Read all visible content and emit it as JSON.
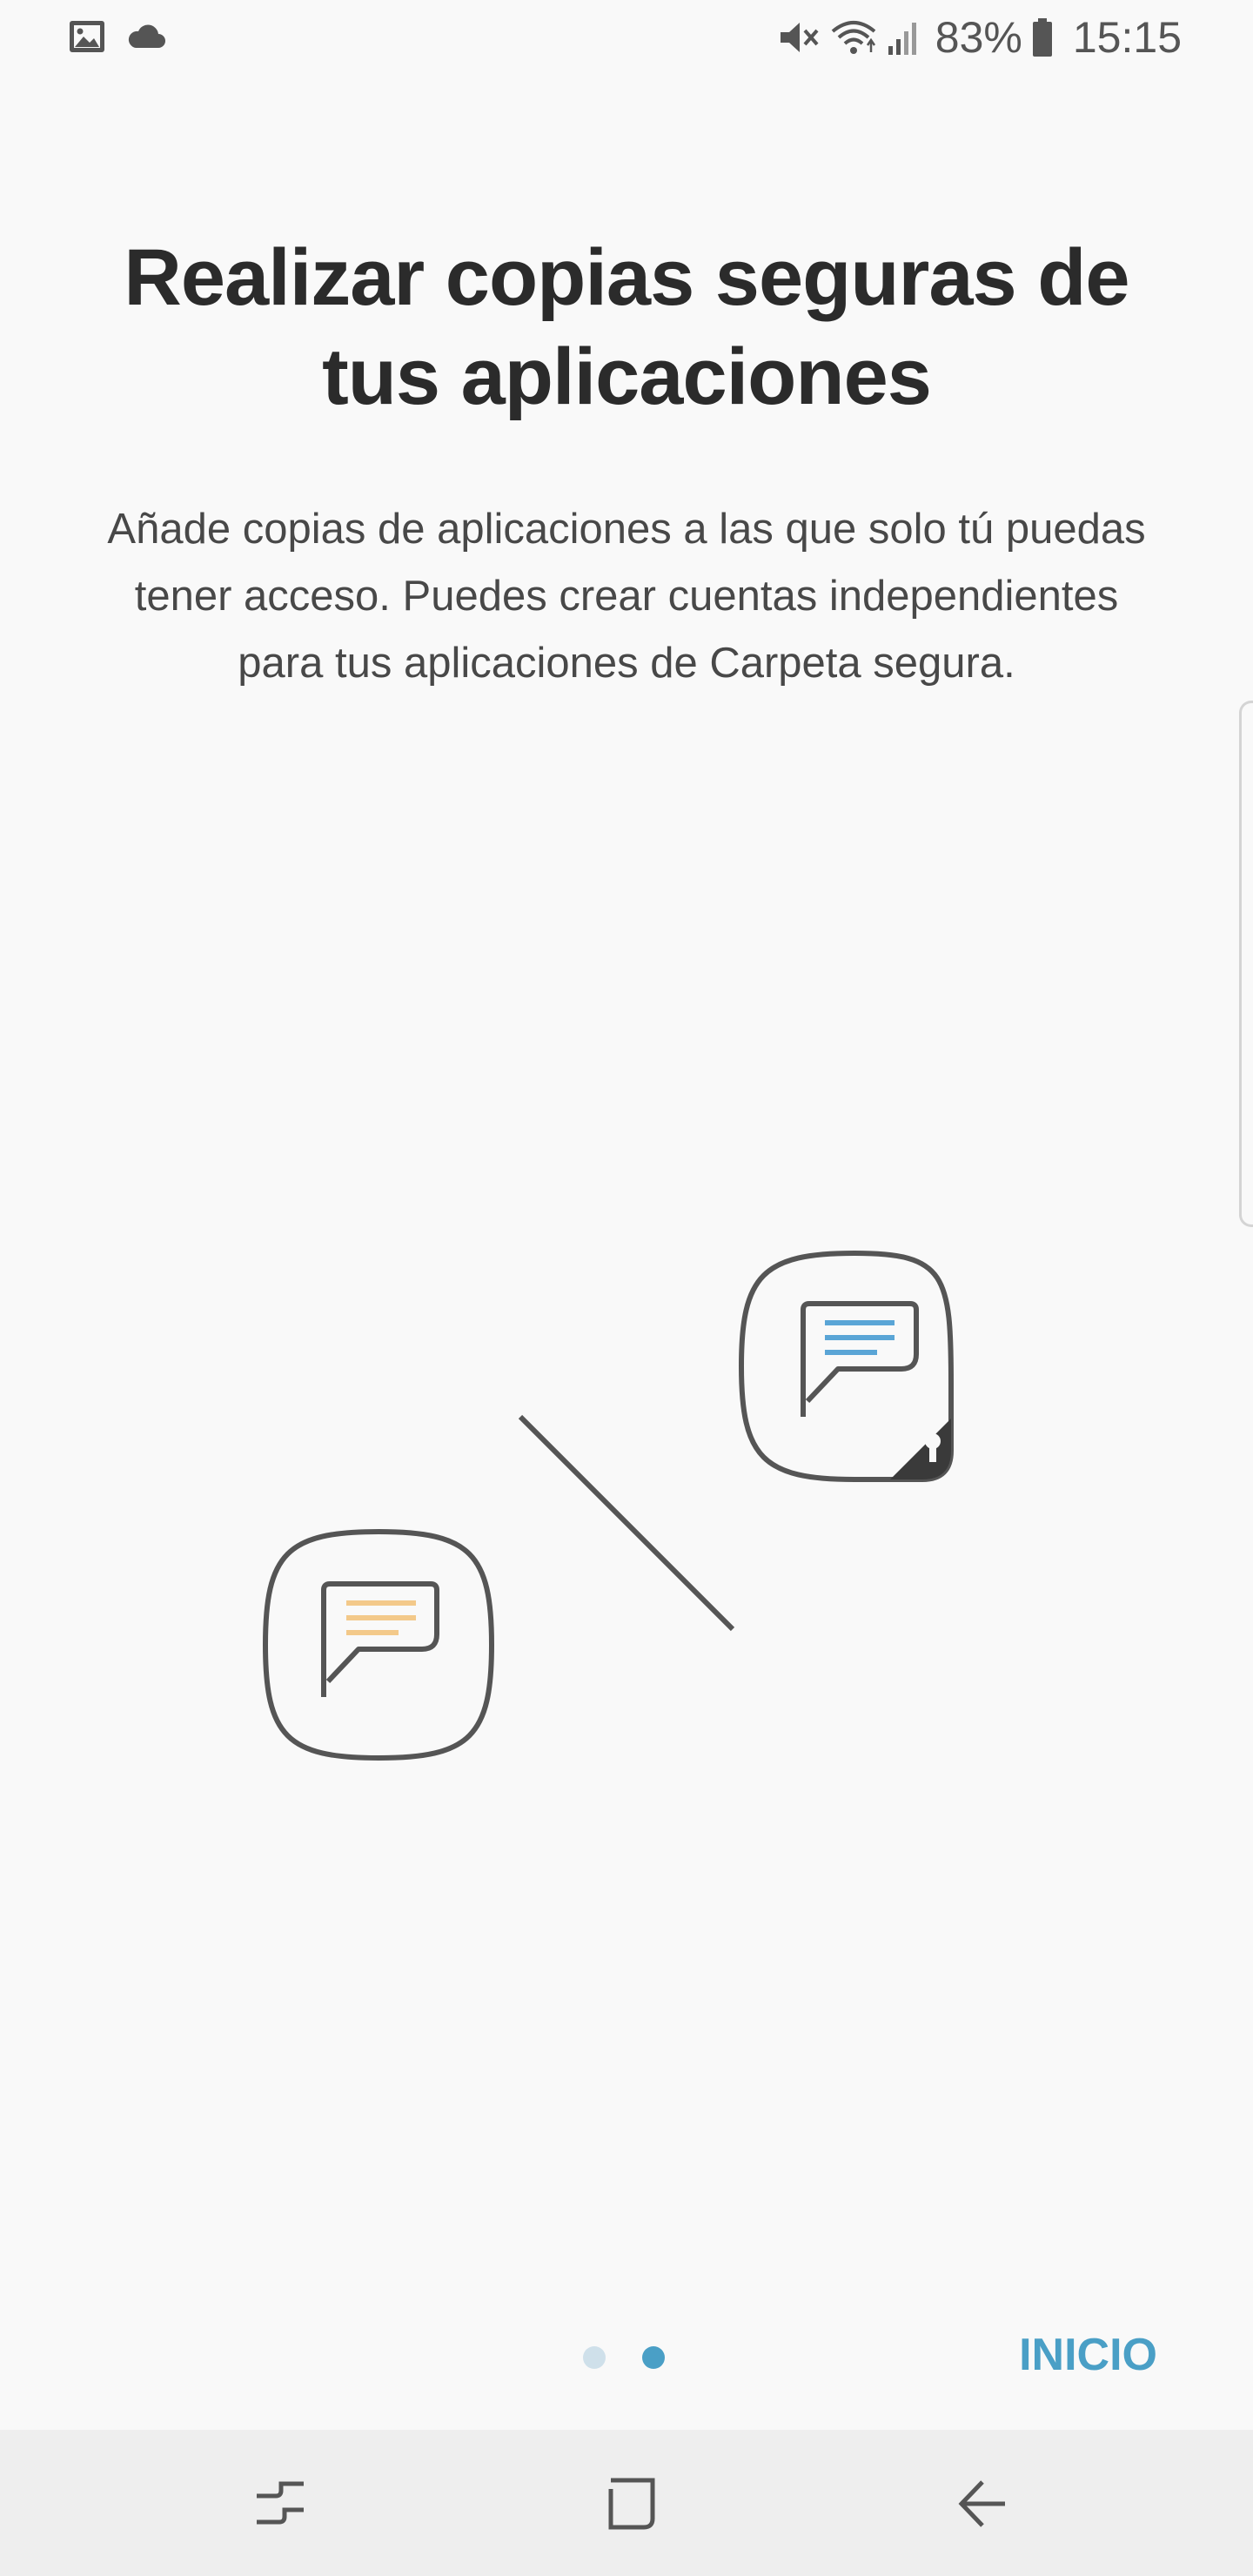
{
  "status_bar": {
    "battery": "83%",
    "time": "15:15",
    "left_icons": [
      "image-icon",
      "cloud-icon"
    ],
    "right_icons": [
      "mute-icon",
      "wifi-icon",
      "signal-icon",
      "battery-icon"
    ]
  },
  "content": {
    "title": "Realizar copias seguras de tus aplicaciones",
    "description": "Añade copias de aplicaciones a las que solo tú puedas tener acceso. Puedes crear cuentas independientes para tus aplicaciones de Carpeta segura."
  },
  "illustration": {
    "icons": [
      "message-app-icon",
      "secure-message-app-icon",
      "lock-icon"
    ]
  },
  "pager": {
    "pages": 2,
    "current": 2,
    "active_color": "#4a9fc6",
    "inactive_color": "#cfe0ea"
  },
  "actions": {
    "start_label": "INICIO",
    "accent": "#4a9fc6"
  },
  "navigation": {
    "buttons": [
      "recent-apps-icon",
      "home-icon",
      "back-icon"
    ]
  }
}
